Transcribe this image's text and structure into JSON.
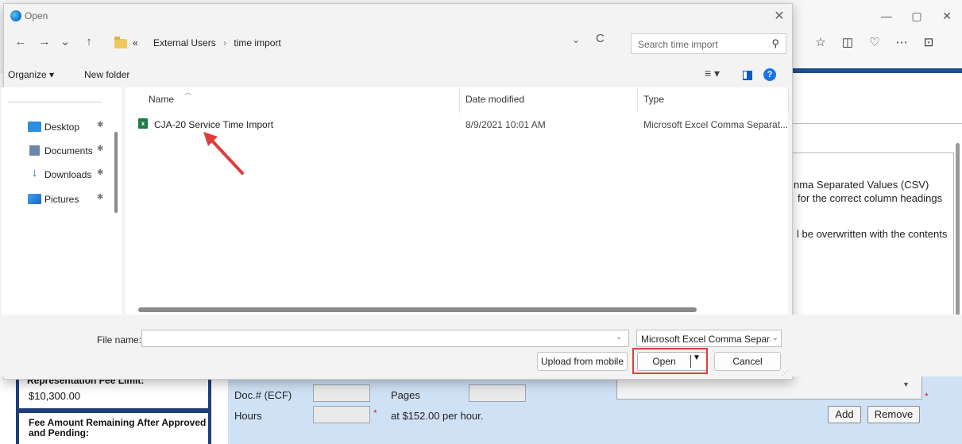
{
  "dialog": {
    "title": "Open",
    "close_glyph": "✕",
    "nav": {
      "back": "←",
      "forward": "→",
      "recent": "⌄",
      "up": "↑"
    },
    "breadcrumb_overflow": "«",
    "breadcrumbs": [
      "External Users",
      "time import"
    ],
    "breadcrumb_sep": "›",
    "address_dropdown": "⌄",
    "refresh": "C",
    "search_placeholder": "Search time import",
    "toolbar": {
      "organize": "Organize ▾",
      "new_folder": "New folder",
      "view_menu": "≡ ▾",
      "help": "?"
    },
    "sidebar": [
      {
        "label": "Desktop",
        "icon": "desktop-icon"
      },
      {
        "label": "Documents",
        "icon": "documents-icon"
      },
      {
        "label": "Downloads",
        "icon": "downloads-icon"
      },
      {
        "label": "Pictures",
        "icon": "pictures-icon"
      }
    ],
    "pin_glyph": "📌",
    "columns": {
      "name": "Name",
      "date_modified": "Date modified",
      "type": "Type"
    },
    "files": [
      {
        "name": "CJA-20 Service Time Import",
        "date_modified": "8/9/2021 10:01 AM",
        "type": "Microsoft Excel Comma Separat...",
        "icon": "excel-icon"
      }
    ],
    "file_name_label": "File name:",
    "file_name_value": "",
    "file_type": "Microsoft Excel Comma Separat",
    "buttons": {
      "upload": "Upload from mobile",
      "open": "Open",
      "cancel": "Cancel"
    }
  },
  "browser": {
    "window_controls": [
      "—",
      "▢",
      "✕"
    ],
    "toolbar_icons": [
      "☆",
      "◫",
      "♡",
      "⋯",
      "⊡"
    ]
  },
  "page": {
    "info_line1": "nma Separated Values (CSV)",
    "info_line2": "for the correct column headings",
    "info_line3": "l be overwritten with the contents",
    "rep_fee_limit_label": "Representation Fee Limit:",
    "rep_fee_limit_value": "$10,300.00",
    "fee_remaining_label": "Fee Amount Remaining After Approved and Pending:",
    "doc_label": "Doc.# (ECF)",
    "pages_label": "Pages",
    "hours_label": "Hours",
    "rate_text": "at $152.00 per hour.",
    "add_button": "Add",
    "remove_button": "Remove",
    "required_mark": "*"
  },
  "colors": {
    "highlight": "#e03c3c",
    "arrow": "#e03c3c",
    "page_blue": "#1e3f7a",
    "form_blue": "#cfe1f5"
  }
}
